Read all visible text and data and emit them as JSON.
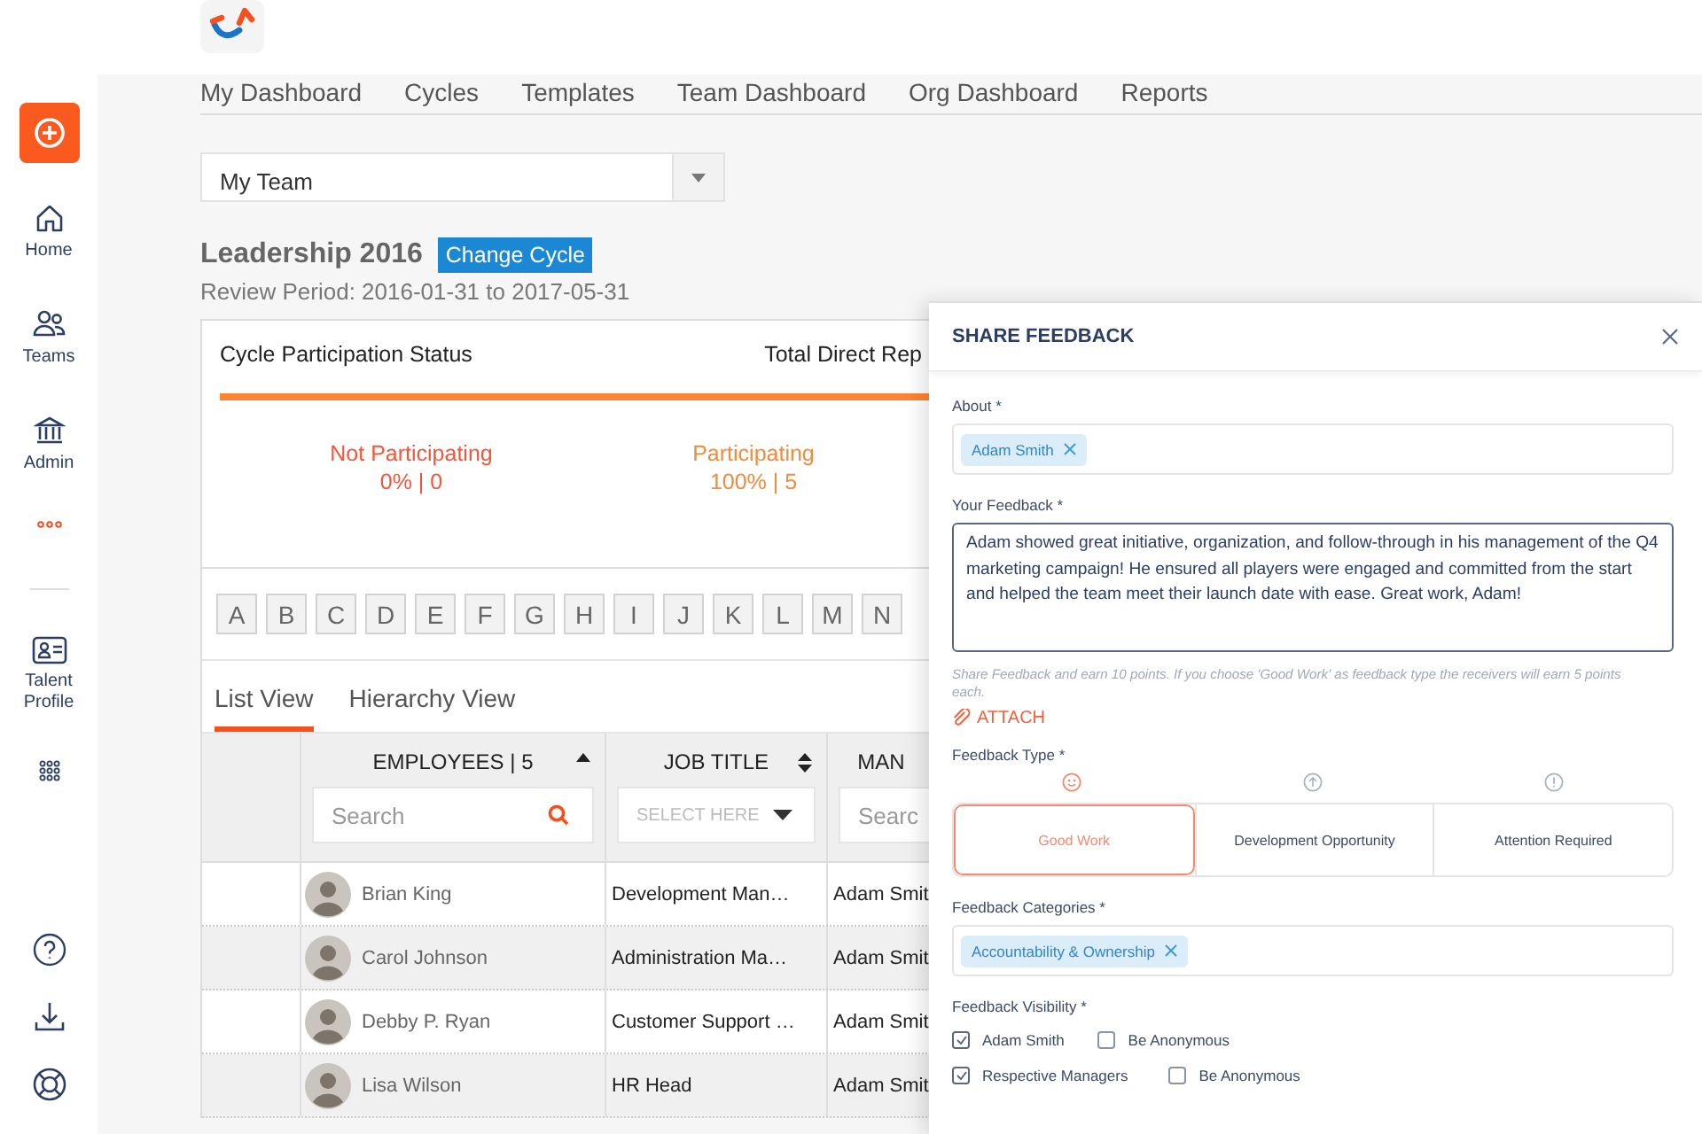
{
  "sidebar": {
    "items": [
      {
        "kind": "add"
      },
      {
        "kind": "home",
        "label": "Home"
      },
      {
        "kind": "teams",
        "label": "Teams"
      },
      {
        "kind": "admin",
        "label": "Admin"
      },
      {
        "kind": "more"
      },
      {
        "kind": "divider"
      },
      {
        "kind": "talent",
        "label": "Talent Profile"
      },
      {
        "kind": "apps"
      },
      {
        "kind": "spacer"
      },
      {
        "kind": "help"
      },
      {
        "kind": "download"
      },
      {
        "kind": "support"
      }
    ]
  },
  "nav_tabs": [
    "My Dashboard",
    "Cycles",
    "Templates",
    "Team Dashboard",
    "Org Dashboard",
    "Reports"
  ],
  "team_select": {
    "value": "My Team"
  },
  "cycle": {
    "title": "Leadership 2016",
    "button": "Change Cycle",
    "review_period": "Review Period: 2016-01-31 to 2017-05-31"
  },
  "participation": {
    "title": "Cycle Participation Status",
    "second_title": "Total Direct Rep",
    "level": 1,
    "stats": [
      {
        "label": "Not Participating",
        "value": "0% | 0",
        "color": "#f4553b"
      },
      {
        "label": "Participating",
        "value": "100% | 5",
        "color": "#f58a3c"
      }
    ]
  },
  "letters": [
    "A",
    "B",
    "C",
    "D",
    "E",
    "F",
    "G",
    "H",
    "I",
    "J",
    "K",
    "L",
    "M",
    "N"
  ],
  "view_tabs": [
    {
      "label": "List View",
      "selected": true
    },
    {
      "label": "Hierarchy View",
      "selected": false
    }
  ],
  "table": {
    "columns": [
      {
        "label": "EMPLOYEES | 5",
        "sortable": true,
        "sorted_ascending": true,
        "filter": {
          "kind": "search",
          "placeholder": "Search"
        }
      },
      {
        "label": "JOB TITLE",
        "sortable": true,
        "sorted_ascending": false,
        "filter": {
          "kind": "select",
          "placeholder": "SELECT HERE"
        }
      },
      {
        "label": "MAN",
        "filter": {
          "kind": "search",
          "placeholder": "Searc"
        }
      }
    ],
    "rows": [
      {
        "name": "Brian King",
        "job_title": "Development Man…",
        "manager": "Adam Smit"
      },
      {
        "name": "Carol Johnson",
        "job_title": "Administration Ma…",
        "manager": "Adam Smit"
      },
      {
        "name": "Debby P. Ryan",
        "job_title": "Customer Support …",
        "manager": "Adam Smit"
      },
      {
        "name": "Lisa Wilson",
        "job_title": "HR Head",
        "manager": "Adam Smit"
      }
    ]
  },
  "panel": {
    "title": "SHARE FEEDBACK",
    "about": {
      "label": "About *",
      "tags": [
        "Adam Smith"
      ]
    },
    "feedback": {
      "label": "Your Feedback *",
      "value": "Adam showed great initiative, organization, and follow-through in his management of the Q4 marketing campaign! He ensured all players were engaged and committed from the start and helped the team meet their launch date with ease. Great work, Adam!"
    },
    "hint": "Share Feedback and earn 10 points. If you choose 'Good Work' as feedback type the receivers will earn 5 points each.",
    "attach": "ATTACH",
    "type": {
      "label": "Feedback Type *",
      "options": [
        {
          "label": "Good Work",
          "kind": "smile",
          "selected": true
        },
        {
          "label": "Development Opportunity",
          "kind": "up",
          "selected": false
        },
        {
          "label": "Attention Required",
          "kind": "alert",
          "selected": false
        }
      ]
    },
    "categories": {
      "label": "Feedback Categories *",
      "tags": [
        "Accountability & Ownership"
      ]
    },
    "visibility": {
      "label": "Feedback Visibility *",
      "rows": [
        {
          "label": "Adam Smith",
          "checked": true,
          "anon_label": "Be Anonymous",
          "anonymous": false
        },
        {
          "label": "Respective Managers",
          "checked": true,
          "anon_label": "Be Anonymous",
          "anonymous": false
        }
      ]
    }
  }
}
